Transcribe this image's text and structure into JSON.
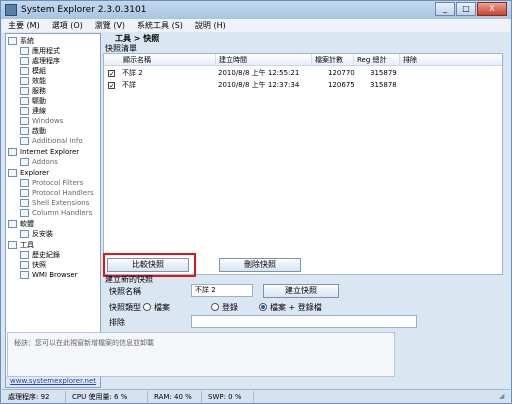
{
  "window": {
    "title": "System Explorer 2.3.0.3101",
    "controls": [
      "_",
      "□",
      "X"
    ]
  },
  "menu": [
    "主要 (M)",
    "選項 (O)",
    "瀏覽 (V)",
    "系統工具 (S)",
    "說明 (H)"
  ],
  "sidebar": {
    "items": [
      {
        "label": "系統",
        "level": 0
      },
      {
        "label": "應用程式",
        "level": 1
      },
      {
        "label": "處理程序",
        "level": 1
      },
      {
        "label": "模組",
        "level": 1
      },
      {
        "label": "效能",
        "level": 1
      },
      {
        "label": "服務",
        "level": 1
      },
      {
        "label": "驅動",
        "level": 1
      },
      {
        "label": "連線",
        "level": 1
      },
      {
        "label": "Windows",
        "level": 1
      },
      {
        "label": "啟動",
        "level": 1
      },
      {
        "label": "Additional Info",
        "level": 1
      },
      {
        "label": "Internet Explorer",
        "level": 0
      },
      {
        "label": "Addons",
        "level": 1
      },
      {
        "label": "Explorer",
        "level": 0
      },
      {
        "label": "Protocol Filters",
        "level": 1
      },
      {
        "label": "Protocol Handlers",
        "level": 1
      },
      {
        "label": "Shell Extensions",
        "level": 1
      },
      {
        "label": "Column Handlers",
        "level": 1
      },
      {
        "label": "軟體",
        "level": 0
      },
      {
        "label": "反安裝",
        "level": 1
      },
      {
        "label": "工具",
        "level": 0
      },
      {
        "label": "歷史紀錄",
        "level": 1
      },
      {
        "label": "快照",
        "level": 1
      },
      {
        "label": "WMI Browser",
        "level": 1
      }
    ],
    "footer_link": "www.systemexplorer.net"
  },
  "main": {
    "breadcrumb": "工具 > 快照",
    "section_title": "快照清單",
    "columns": [
      "顯示名稱",
      "建立時間",
      "檔案計數",
      "Reg 總計",
      "排除"
    ],
    "rows": [
      {
        "checked": true,
        "name": "不詳 2",
        "created": "2010/8/8 上午 12:55:21",
        "file_count": "120770",
        "reg_total": "315879",
        "exclude": ""
      },
      {
        "checked": true,
        "name": "不詳",
        "created": "2010/8/8 上午 12:37:34",
        "file_count": "120675",
        "reg_total": "315878",
        "exclude": ""
      }
    ],
    "compare_button": "比較快照",
    "delete_button": "刪除快照",
    "new_snapshot": {
      "title": "建立新的快照",
      "name_label": "快照名稱",
      "name_value": "不詳 2",
      "create_button": "建立快照",
      "type_label": "快照類型",
      "type_options": [
        "檔案",
        "登錄",
        "檔案 + 登錄檔"
      ],
      "type_selected": "檔案 + 登錄檔",
      "exclude_label": "排除",
      "exclude_value": "",
      "hint": "秘訣：您可以在此視窗新增檔案的信息並卸載"
    }
  },
  "status": {
    "processes": "處理程序: 92",
    "cpu": "CPU 使用量: 6 %",
    "ram": "RAM: 40 %",
    "swp": "SWP: 0 %"
  },
  "colors": {
    "highlight_box": "#e0161b",
    "link": "#2044c0"
  }
}
